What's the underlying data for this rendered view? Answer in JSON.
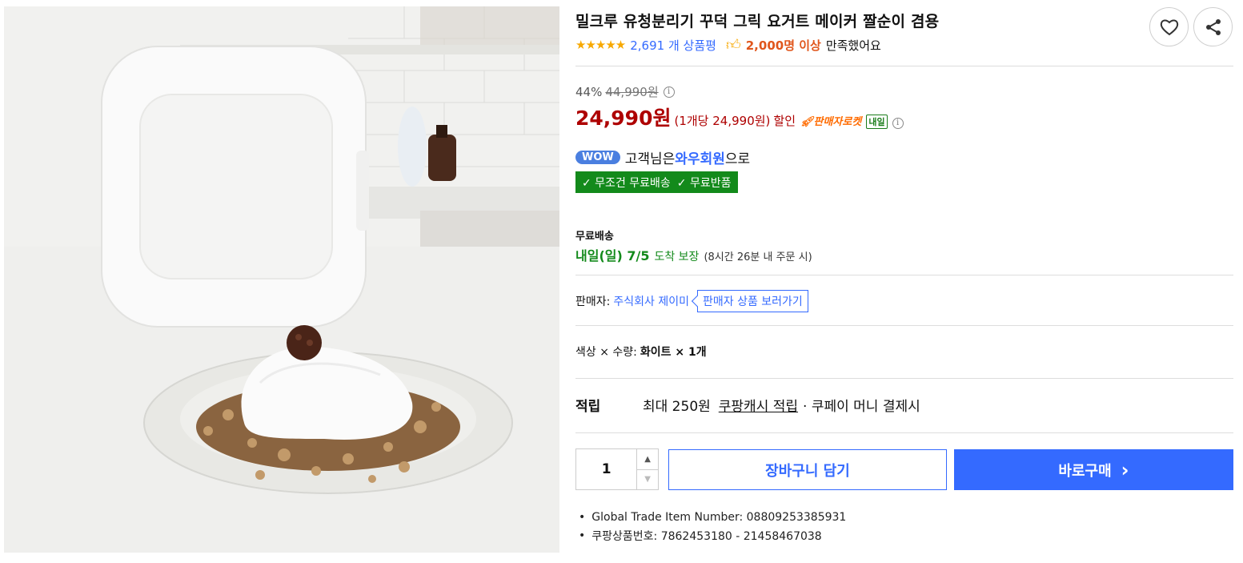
{
  "product": {
    "title": "밀크루 유청분리기 꾸덕 그릭 요거트 메이커 짤순이 겸용",
    "image_alt": "product photo: white square yogurt maker container with greek yogurt on granola plate"
  },
  "actions": {
    "wish_icon": "heart-outline",
    "share_icon": "share"
  },
  "rating": {
    "stars": "★★★★★",
    "review_count": "2,691 개 상품평",
    "satisfaction_icon": "thumbs-up",
    "satisfaction_strong": "2,000명 이상",
    "satisfaction_rest": "만족했어요"
  },
  "price": {
    "discount_rate": "44%",
    "original": "44,990원",
    "sale": "24,990원",
    "unit": "(1개당 24,990원)",
    "discount_label": "할인",
    "rocket_label": "판매자로켓",
    "tomorrow_badge": "내일",
    "info_glyph": "i"
  },
  "wow": {
    "badge": "WOW",
    "prefix": "고객님은",
    "member": "와우회원",
    "suffix": "으로",
    "benefit_1": "✓ 무조건 무료배송",
    "benefit_2": "✓ 무료반품"
  },
  "shipping": {
    "title": "무료배송",
    "date": "내일(일) 7/5",
    "guarantee": "도착 보장",
    "note": "(8시간 26분 내 주문 시)"
  },
  "seller": {
    "label": "판매자:",
    "name": "주식회사 제이미",
    "link": "판매자 상품 보러가기"
  },
  "option": {
    "label": "색상 × 수량:",
    "value": "화이트 × 1개"
  },
  "reward": {
    "label": "적립",
    "amount": "최대 250원",
    "cash": "쿠팡캐시 적립",
    "condition": "· 쿠페이 머니 결제시"
  },
  "purchase": {
    "quantity": "1",
    "up": "▲",
    "down": "▼",
    "cart_label": "장바구니 담기",
    "buy_label": "바로구매",
    "buy_chevron": "›"
  },
  "meta": {
    "gtin": "Global Trade Item Number: 08809253385931",
    "coupang_id": "쿠팡상품번호: 7862453180 - 21458467038"
  },
  "colors": {
    "accent_blue": "#346aff",
    "price_red": "#ae0000",
    "green": "#138a1b",
    "star": "#f7a800"
  }
}
